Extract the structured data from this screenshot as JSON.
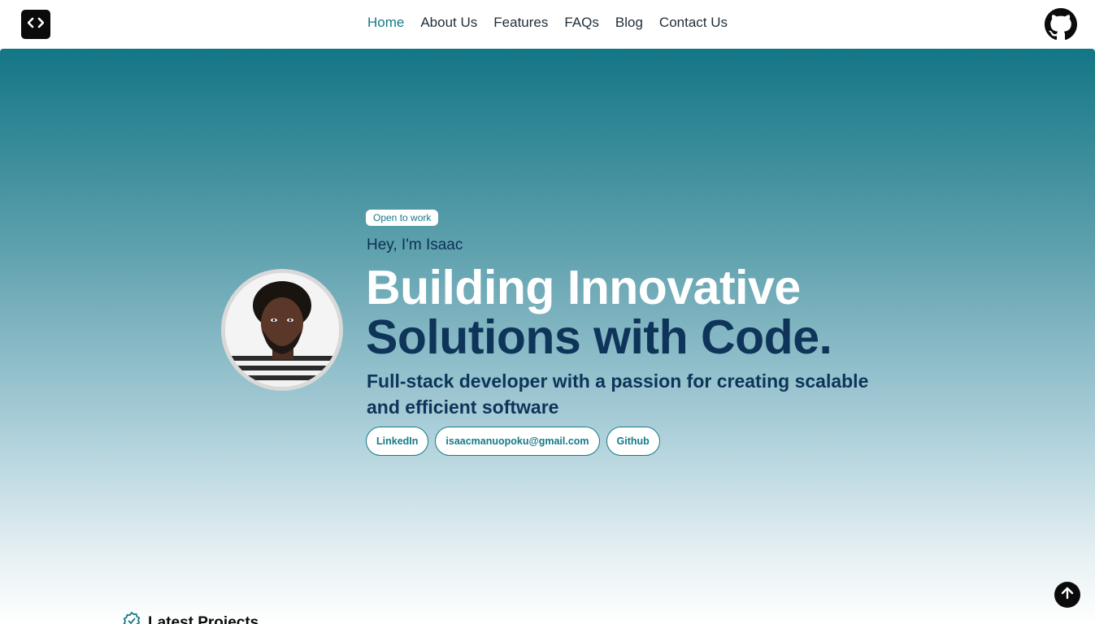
{
  "nav": {
    "items": [
      "Home",
      "About Us",
      "Features",
      "FAQs",
      "Blog",
      "Contact Us"
    ],
    "active": "Home"
  },
  "icons": {
    "logo": "code-brackets-icon",
    "header_right": "github-icon",
    "scroll": "arrow-up-icon",
    "section": "badge-check-icon"
  },
  "hero": {
    "badge": "Open to work",
    "greeting": "Hey, I'm Isaac",
    "headline_line1": "Building Innovative",
    "headline_line2": "Solutions with Code.",
    "subtitle": "Full-stack developer with a passion for creating scalable and efficient software",
    "links": [
      "LinkedIn",
      "isaacmanuopoku@gmail.com",
      "Github"
    ]
  },
  "section": {
    "title": "Latest Projects"
  },
  "colors": {
    "accent": "#157a87",
    "navy": "#0e3559",
    "dark": "#0b0b0b"
  }
}
